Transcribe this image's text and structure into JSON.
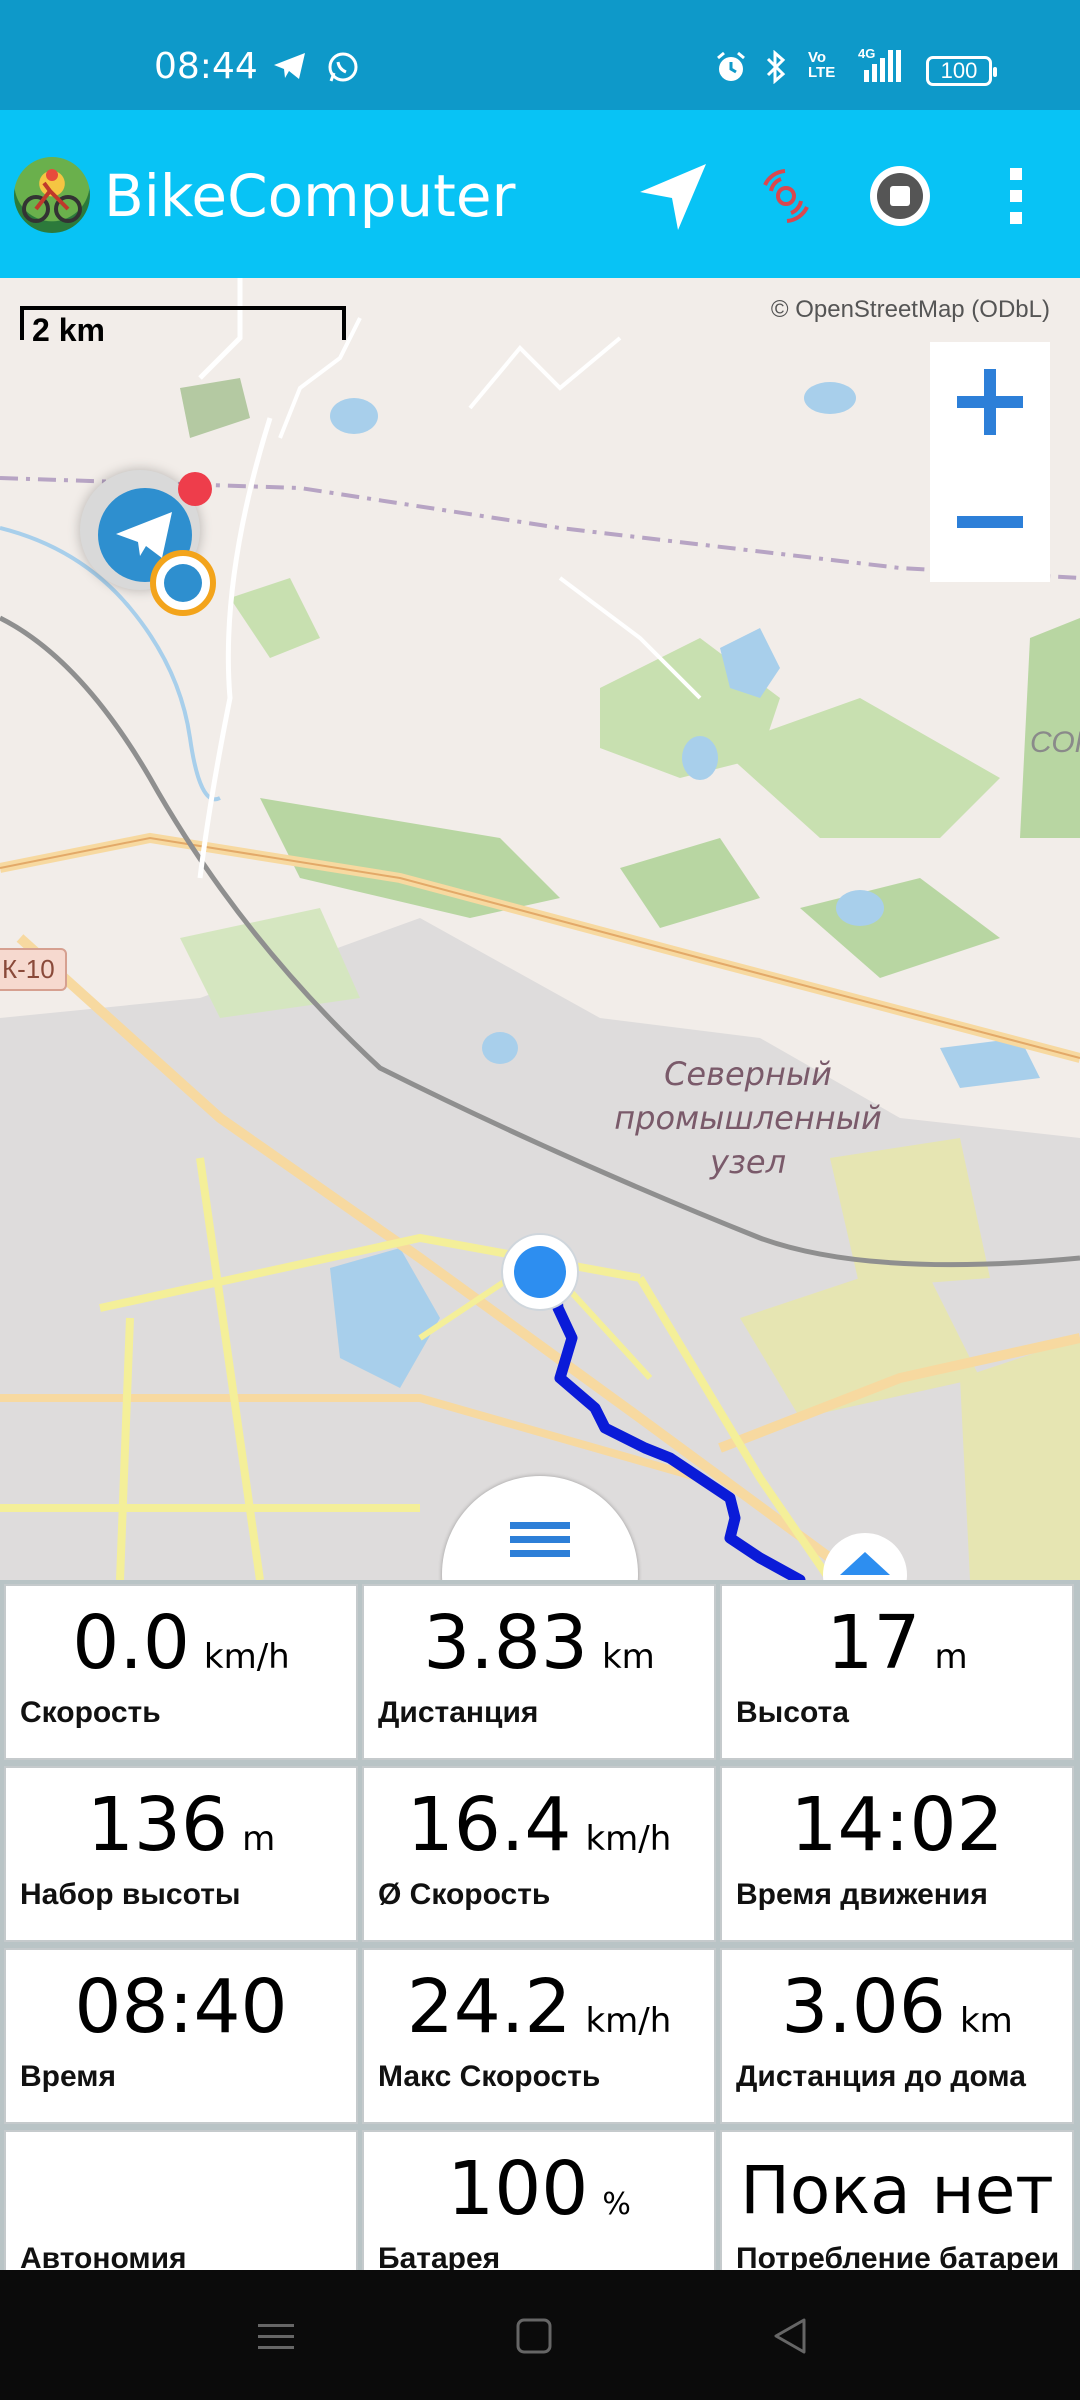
{
  "status_bar": {
    "time": "08:44",
    "battery": "100",
    "network": "4G",
    "icons": [
      "telegram-icon",
      "whatsapp-icon",
      "alarm-icon",
      "bluetooth-icon",
      "volte-icon",
      "signal-icon",
      "battery-icon"
    ]
  },
  "app": {
    "title": "BikeComputer",
    "actions": [
      "navigation-arrow-icon",
      "sensor-connect-icon",
      "stop-record-icon",
      "overflow-menu-icon"
    ]
  },
  "map": {
    "scale": "2 km",
    "attribution": "© OpenStreetMap (ODbL)",
    "road_shield": "К-10",
    "place_label": [
      "Северный",
      "промышленный",
      "узел"
    ],
    "edge_label": "СОК",
    "colors": {
      "route": "#0a1bd8",
      "position": "#2d8ef0",
      "accent": "#08c3f5"
    }
  },
  "dashboard": [
    {
      "value": "0.0",
      "unit": "km/h",
      "label": "Скорость"
    },
    {
      "value": "3.83",
      "unit": "km",
      "label": "Дистанция"
    },
    {
      "value": "17",
      "unit": "m",
      "label": "Высота"
    },
    {
      "value": "136",
      "unit": "m",
      "label": "Набор высоты"
    },
    {
      "value": "16.4",
      "unit": "km/h",
      "label": "Ø Скорость"
    },
    {
      "value": "14:02",
      "unit": "",
      "label": "Время движения"
    },
    {
      "value": "08:40",
      "unit": "",
      "label": "Время"
    },
    {
      "value": "24.2",
      "unit": "km/h",
      "label": "Макс Скорость"
    },
    {
      "value": "3.06",
      "unit": "km",
      "label": "Дистанция до дома"
    },
    {
      "value": "",
      "unit": "",
      "label": "Автономия"
    },
    {
      "value": "100",
      "unit": "%",
      "label": "Батарея"
    },
    {
      "value": "Пока нет",
      "unit": "",
      "label": "Потребление батареи"
    }
  ]
}
